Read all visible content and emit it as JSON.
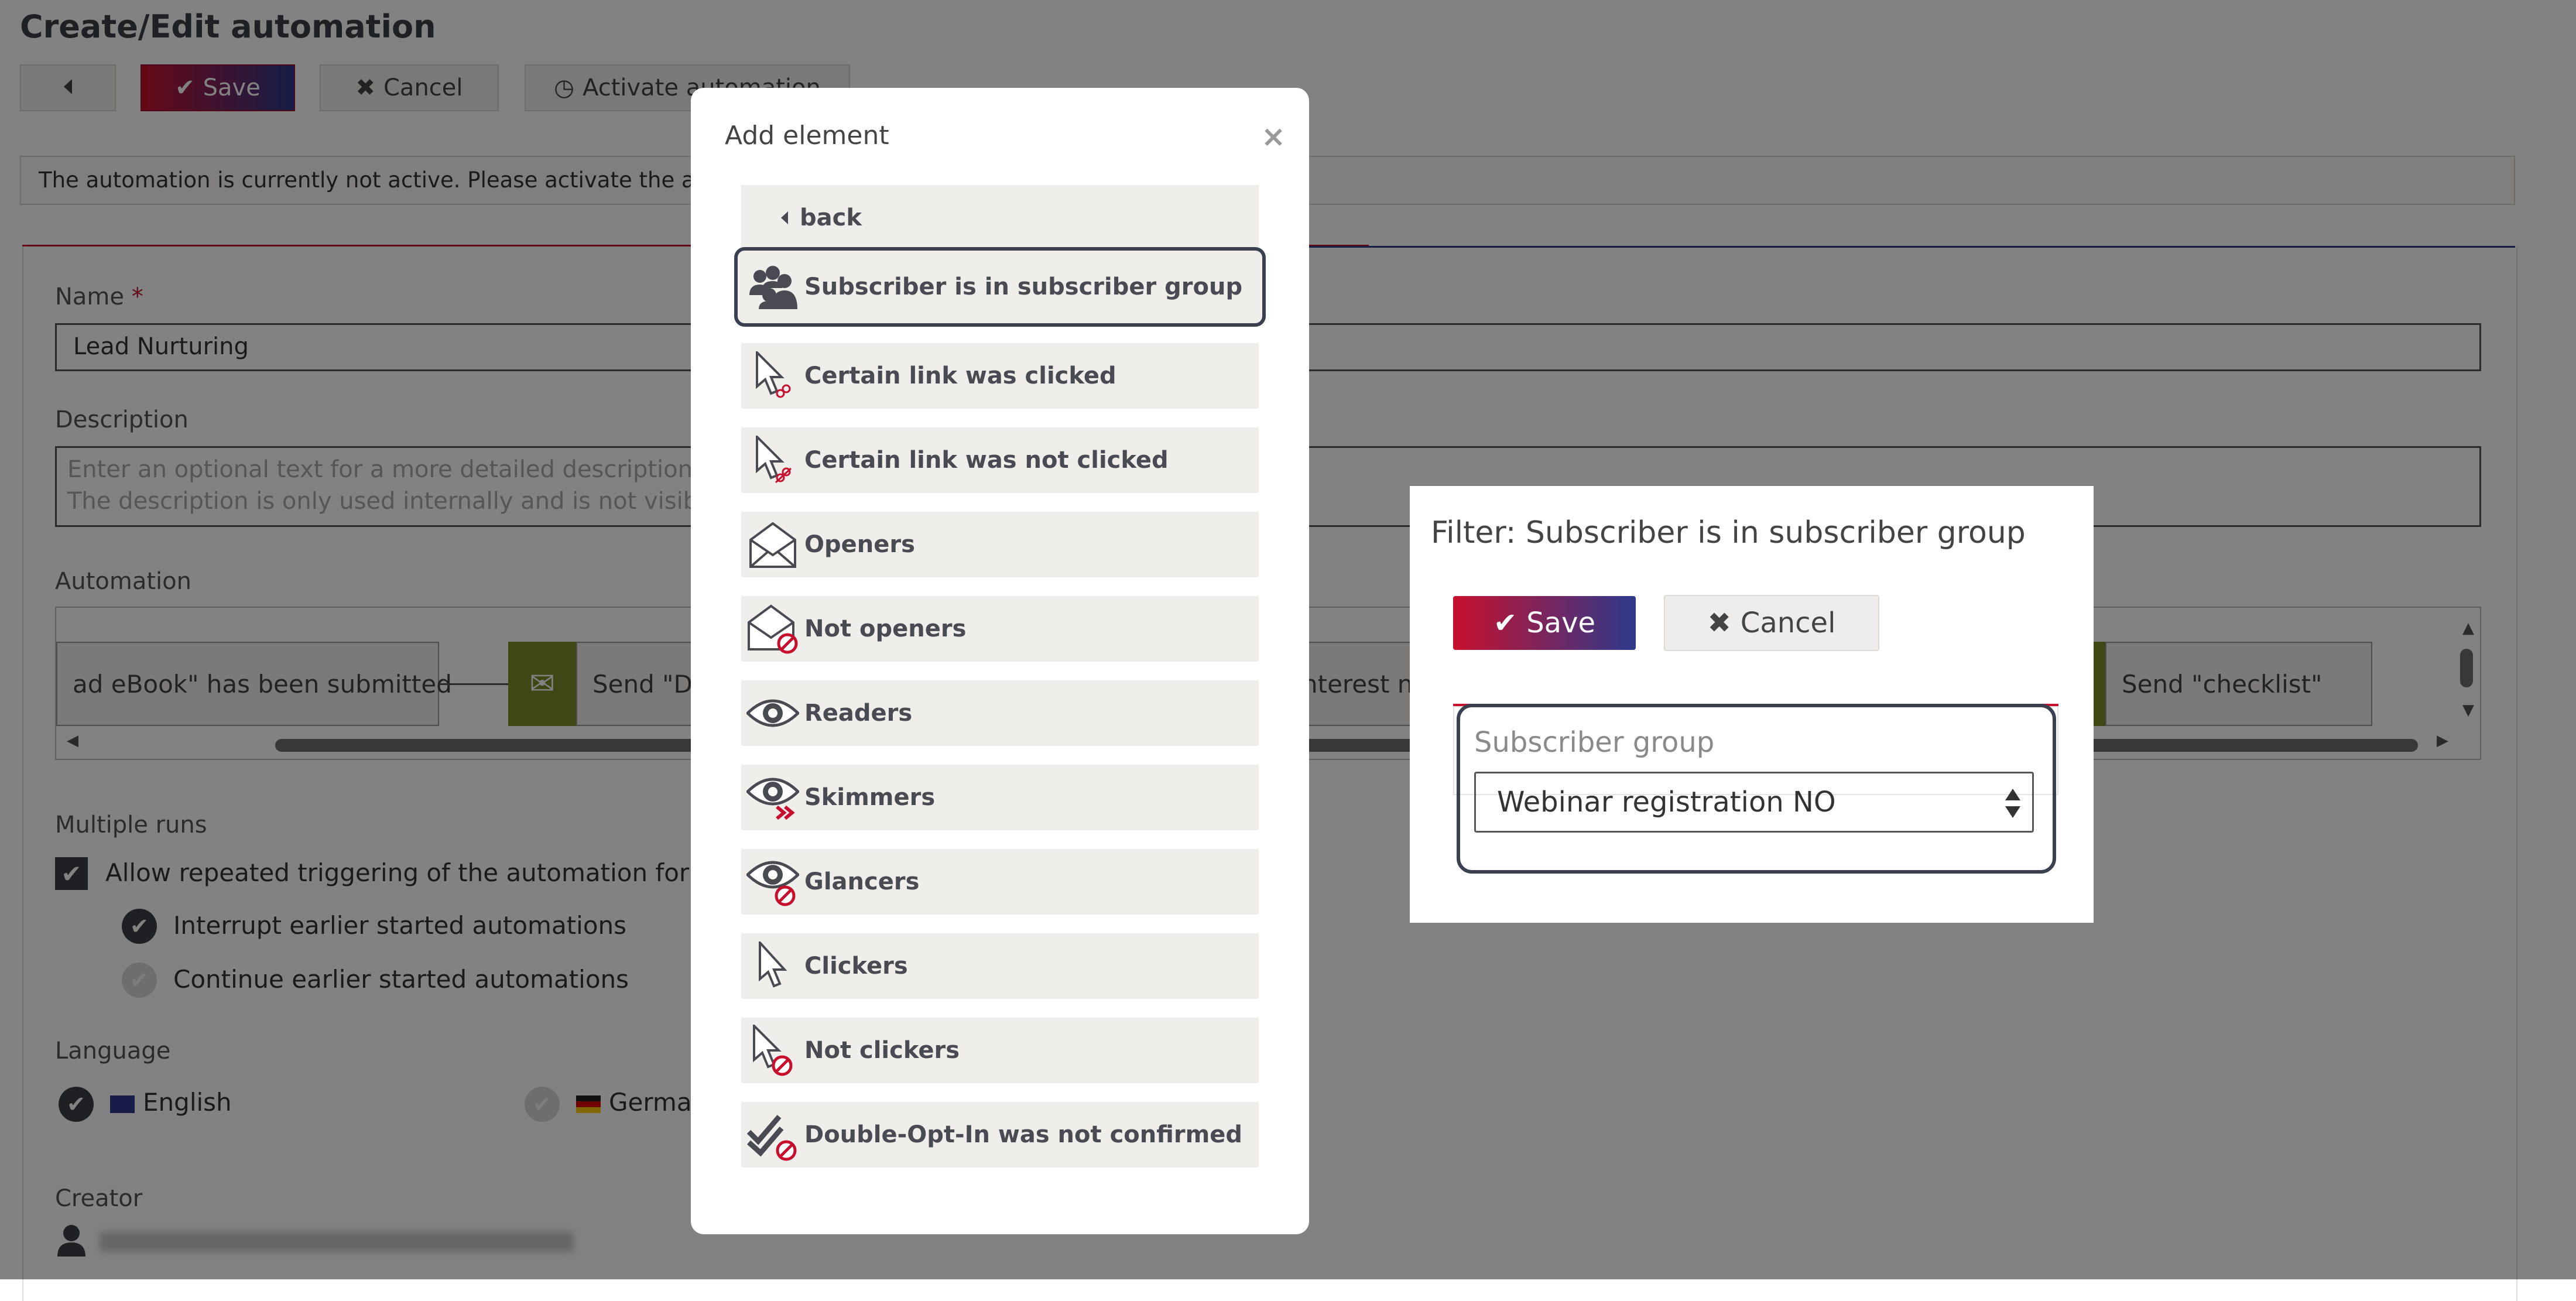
{
  "page": {
    "title": "Create/Edit automation",
    "toolbar": {
      "back_icon": "chevron-left-icon",
      "save_label": "Save",
      "cancel_label": "Cancel",
      "activate_label": "Activate automation"
    },
    "notice": "The automation is currently not active. Please activate the automation",
    "name_label": "Name",
    "name_required_mark": "*",
    "name_value": "Lead Nurturing",
    "description_label": "Description",
    "description_placeholder": "Enter an optional text for a more detailed description\nThe description is only used internally and is not visible",
    "automation_label": "Automation",
    "nodes": [
      {
        "label": "ad eBook\" has been submitted"
      },
      {
        "label": "Send \"D"
      },
      {
        "label": "nterest n"
      },
      {
        "label": "Send \"checklist\""
      }
    ],
    "multiple_runs_label": "Multiple runs",
    "allow_repeat_label": "Allow repeated triggering of the automation for e",
    "interrupt_label": "Interrupt earlier started automations",
    "continue_label": "Continue earlier started automations",
    "language_label": "Language",
    "lang_english": "English",
    "lang_german": "Germa",
    "creator_label": "Creator"
  },
  "modal": {
    "title": "Add element",
    "close_glyph": "×",
    "back_label": "back",
    "items": [
      {
        "label": "Subscriber is in subscriber group",
        "icon": "users-group-icon"
      },
      {
        "label": "Certain link was clicked",
        "icon": "cursor-link-icon"
      },
      {
        "label": "Certain link was not clicked",
        "icon": "cursor-link-not-icon"
      },
      {
        "label": "Openers",
        "icon": "envelope-open-icon"
      },
      {
        "label": "Not openers",
        "icon": "envelope-not-icon"
      },
      {
        "label": "Readers",
        "icon": "eye-icon"
      },
      {
        "label": "Skimmers",
        "icon": "eye-skim-icon"
      },
      {
        "label": "Glancers",
        "icon": "eye-not-icon"
      },
      {
        "label": "Clickers",
        "icon": "cursor-icon"
      },
      {
        "label": "Not clickers",
        "icon": "cursor-not-icon"
      },
      {
        "label": "Double-Opt-In was not confirmed",
        "icon": "double-check-not-icon"
      }
    ]
  },
  "filter": {
    "title": "Filter: Subscriber is in subscriber group",
    "save_label": "Save",
    "cancel_label": "Cancel",
    "group_label": "Subscriber group",
    "group_value": "Webinar registration NO"
  },
  "colors": {
    "brand_red": "#c8102e",
    "brand_blue": "#2d3a8c",
    "node_green": "#7c8c2a",
    "dark": "#3b4050"
  }
}
